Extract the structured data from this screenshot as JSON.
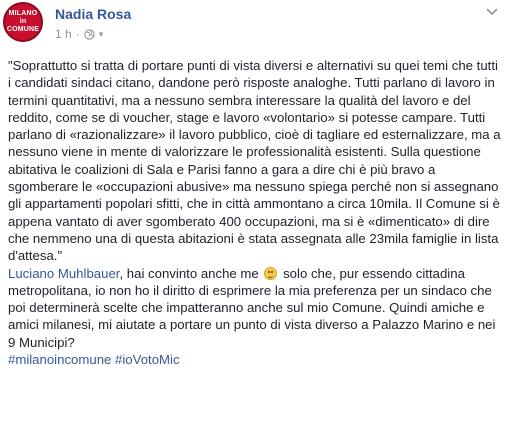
{
  "author": {
    "name": "Nadia Rosa",
    "avatar_lines": [
      "MILANO",
      "in COMUNE"
    ]
  },
  "meta": {
    "timestamp": "1 h",
    "separator": "·",
    "audience_icon": "globe-icon",
    "audience_caret": "▾"
  },
  "options_icon": "chevron-down-icon",
  "post": {
    "quote": "\"Soprattutto si tratta di portare punti di vista diversi e alternativi su quei temi che tutti i candidati sindaci citano, dandone però risposte analoghe. Tutti parlano di lavoro in termini quantitativi, ma a nessuno sembra interessare la qualità del lavoro e del reddito, come se di voucher, stage e lavoro «volontario» si potesse campare. Tutti parlano di «razionalizzare» il lavoro pubblico, cioè di tagliare ed esternalizzare, ma a nessuno viene in mente di valorizzare le professionalità esistenti. Sulla questione abitativa le coalizioni di Sala e Parisi fanno a gara a dire chi è più bravo a sgomberare le «occupazioni abusive» ma nessuno spiega perché non si assegnano gli appartamenti popolari sfitti, che in città ammontano a circa 10mila. Il Comune si è appena vantato di aver sgomberato 400 occupazioni, ma si è «dimenticato» di dire che nemmeno una di questa abitazioni è stata assegnata alle 23mila famiglie in lista d'attesa.\"",
    "mention": "Luciano Muhlbauer",
    "text_before_emoji": ", hai convinto anche me",
    "emoji": "smile-emoji",
    "text_after_emoji": " solo che, pur essendo cittadina metropolitana, io non ho il diritto di esprimere la mia preferenza per un sindaco che poi determinerà scelte che impatteranno anche sul mio Comune. Quindi amiche e amici milanesi, mi aiutate a portare un punto di vista diverso a Palazzo Marino e nei 9 Municipi?",
    "hashtags": [
      "#milanoincomune",
      "#ioVotoMic"
    ]
  },
  "colors": {
    "link": "#365899",
    "text": "#1d2129",
    "meta": "#90949c",
    "avatar": "#c8102e"
  }
}
